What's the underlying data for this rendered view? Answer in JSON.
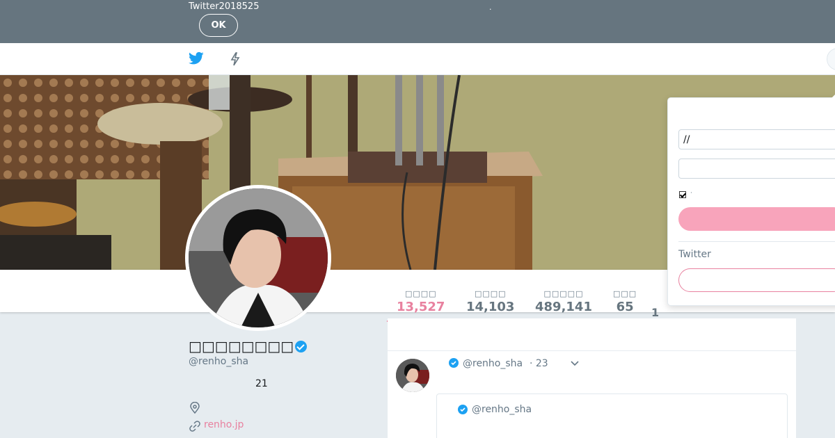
{
  "notice": {
    "text": "Twitter2018525",
    "dot": ".",
    "ok_label": "OK"
  },
  "topbar": {
    "home_icon": "twitter-bird-icon",
    "moments_icon": "lightning-icon"
  },
  "profile": {
    "name": "□□□□□□□□",
    "handle": "@renho_sha",
    "joined": "21",
    "url": "renho.jp"
  },
  "stats": [
    {
      "label": "□□□□",
      "value": "13,527",
      "active": true
    },
    {
      "label": "□□□□",
      "value": "14,103",
      "active": false
    },
    {
      "label": "□□□□□",
      "value": "489,141",
      "active": false
    },
    {
      "label": "□□□",
      "value": "65",
      "active": false
    }
  ],
  "stats_extra_value": "1",
  "tweet": {
    "handle": "@renho_sha",
    "time": "· 23",
    "quote_handle": "@renho_sha"
  },
  "login": {
    "username_value": "//",
    "password_value": "",
    "remember_text": "·",
    "signup_text": "Twitter"
  },
  "colors": {
    "accent": "#e8819f",
    "notice_bg": "#66757f",
    "verified": "#1da1f2"
  }
}
